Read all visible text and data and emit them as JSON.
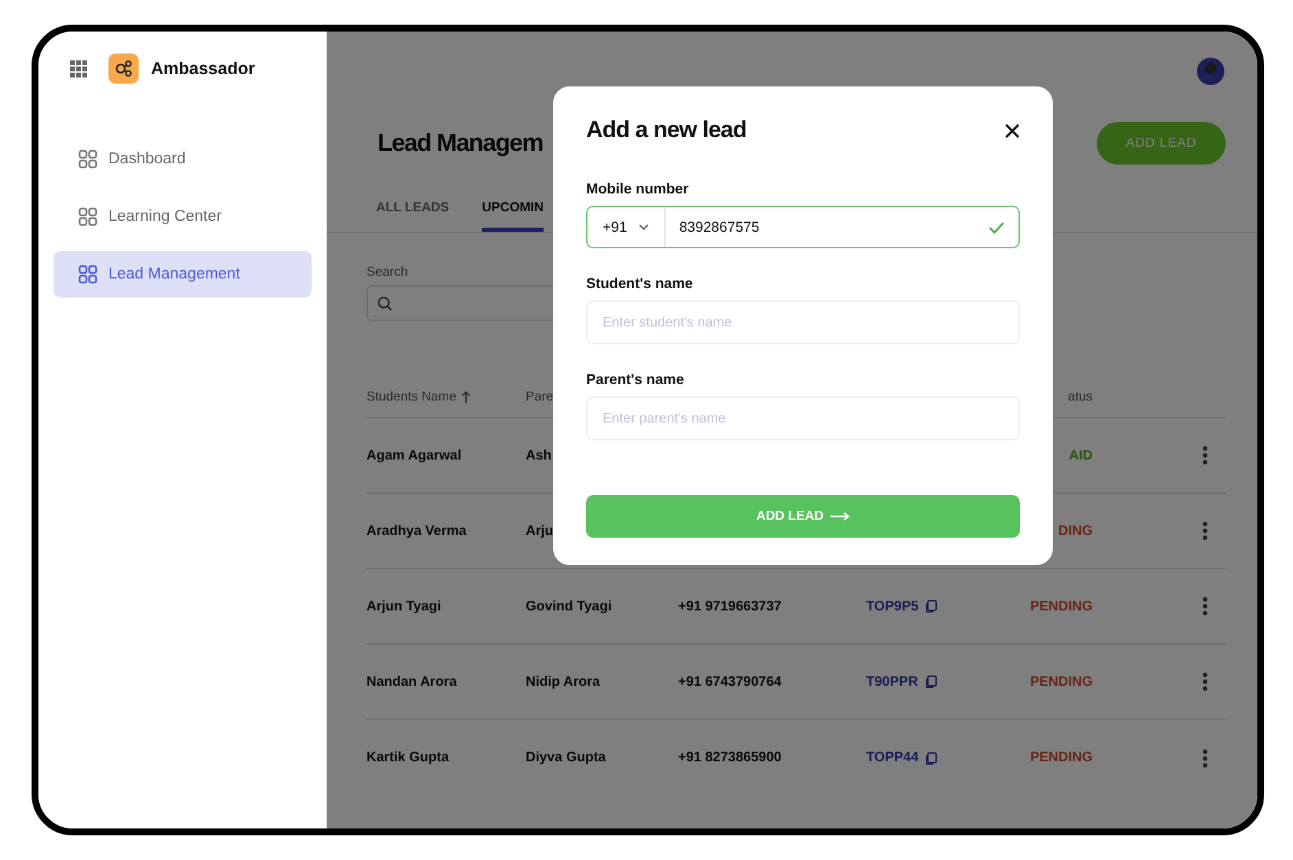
{
  "sidebar": {
    "app_name": "Ambassador",
    "items": [
      {
        "label": "Dashboard",
        "selected": false
      },
      {
        "label": "Learning Center",
        "selected": false
      },
      {
        "label": "Lead Management",
        "selected": true
      }
    ]
  },
  "page": {
    "title": "Lead Managem",
    "add_button": "ADD LEAD",
    "tabs": [
      {
        "label": "ALL LEADS",
        "selected": false
      },
      {
        "label": "UPCOMIN",
        "selected": true
      }
    ],
    "search": {
      "label": "Search"
    },
    "table": {
      "header": {
        "student": "Students Name",
        "parent": "Pare",
        "status": "atus"
      },
      "rows": [
        {
          "student": "Agam Agarwal",
          "parent": "Ash",
          "status": "AID",
          "kind": "paid"
        },
        {
          "student": "Aradhya Verma",
          "parent": "Arju",
          "status": "DING",
          "kind": "pending"
        },
        {
          "student": "Arjun Tyagi",
          "parent": "Govind Tyagi",
          "phone": "+91 9719663737",
          "code": "TOP9P5",
          "status": "PENDING",
          "kind": "pending"
        },
        {
          "student": "Nandan Arora",
          "parent": "Nidip Arora",
          "phone": "+91 6743790764",
          "code": "T90PPR",
          "status": "PENDING",
          "kind": "pending"
        },
        {
          "student": "Kartik Gupta",
          "parent": "Diyva Gupta",
          "phone": "+91 8273865900",
          "code": "TOPP44",
          "status": "PENDING",
          "kind": "pending"
        }
      ]
    }
  },
  "modal": {
    "title": "Add a new lead",
    "mobile": {
      "label": "Mobile number",
      "country_code": "+91",
      "value": "8392867575",
      "valid": true
    },
    "student_name": {
      "label": "Student's name",
      "placeholder": "Enter student's name"
    },
    "parent_name": {
      "label": "Parent's name",
      "placeholder": "Enter parent's name"
    },
    "submit": "ADD LEAD"
  }
}
